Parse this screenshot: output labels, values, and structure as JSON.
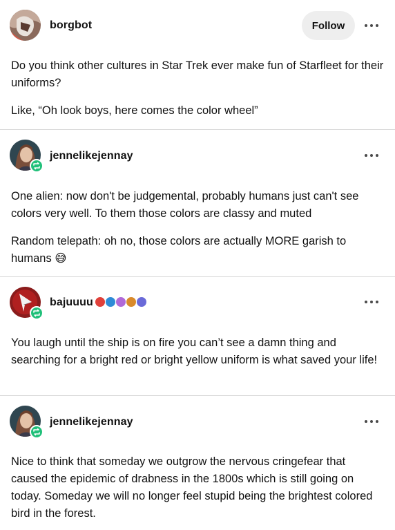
{
  "posts": [
    {
      "username": "borgbot",
      "follow_label": "Follow",
      "paragraphs": [
        "Do you think other cultures in Star Trek ever make fun of Starfleet for their uniforms?",
        "Like, “Oh look boys, here comes the color wheel”"
      ]
    },
    {
      "username": "jennelikejennay",
      "paragraphs": [
        "One alien: now don't be judgemental, probably humans just can't see colors very well. To them those colors are classy and muted",
        "Random telepath: oh no, those colors are actually MORE garish to humans 😅"
      ]
    },
    {
      "username": "bajuuuu",
      "badge_colors": [
        "#e0403a",
        "#2e8bd6",
        "#b06ad8",
        "#d98a2b",
        "#6a6ad8"
      ],
      "paragraphs": [
        "You laugh until the ship is on fire you can’t see a damn thing and searching for a bright red or bright yellow uniform is what saved your life!"
      ]
    },
    {
      "username": "jennelikejennay",
      "paragraphs": [
        "Nice to think that someday we outgrow the nervous cringefear that caused the epidemic of drabness in the 1800s which is still going on today. Someday we will no longer feel stupid being the brightest colored bird in the forest."
      ]
    }
  ],
  "icons": {
    "more": "more-options-icon",
    "reblog": "reblog-icon"
  },
  "colors": {
    "reblog_green": "#21c07a",
    "follow_bg": "#eeeeee",
    "divider": "#d9d9d9"
  }
}
